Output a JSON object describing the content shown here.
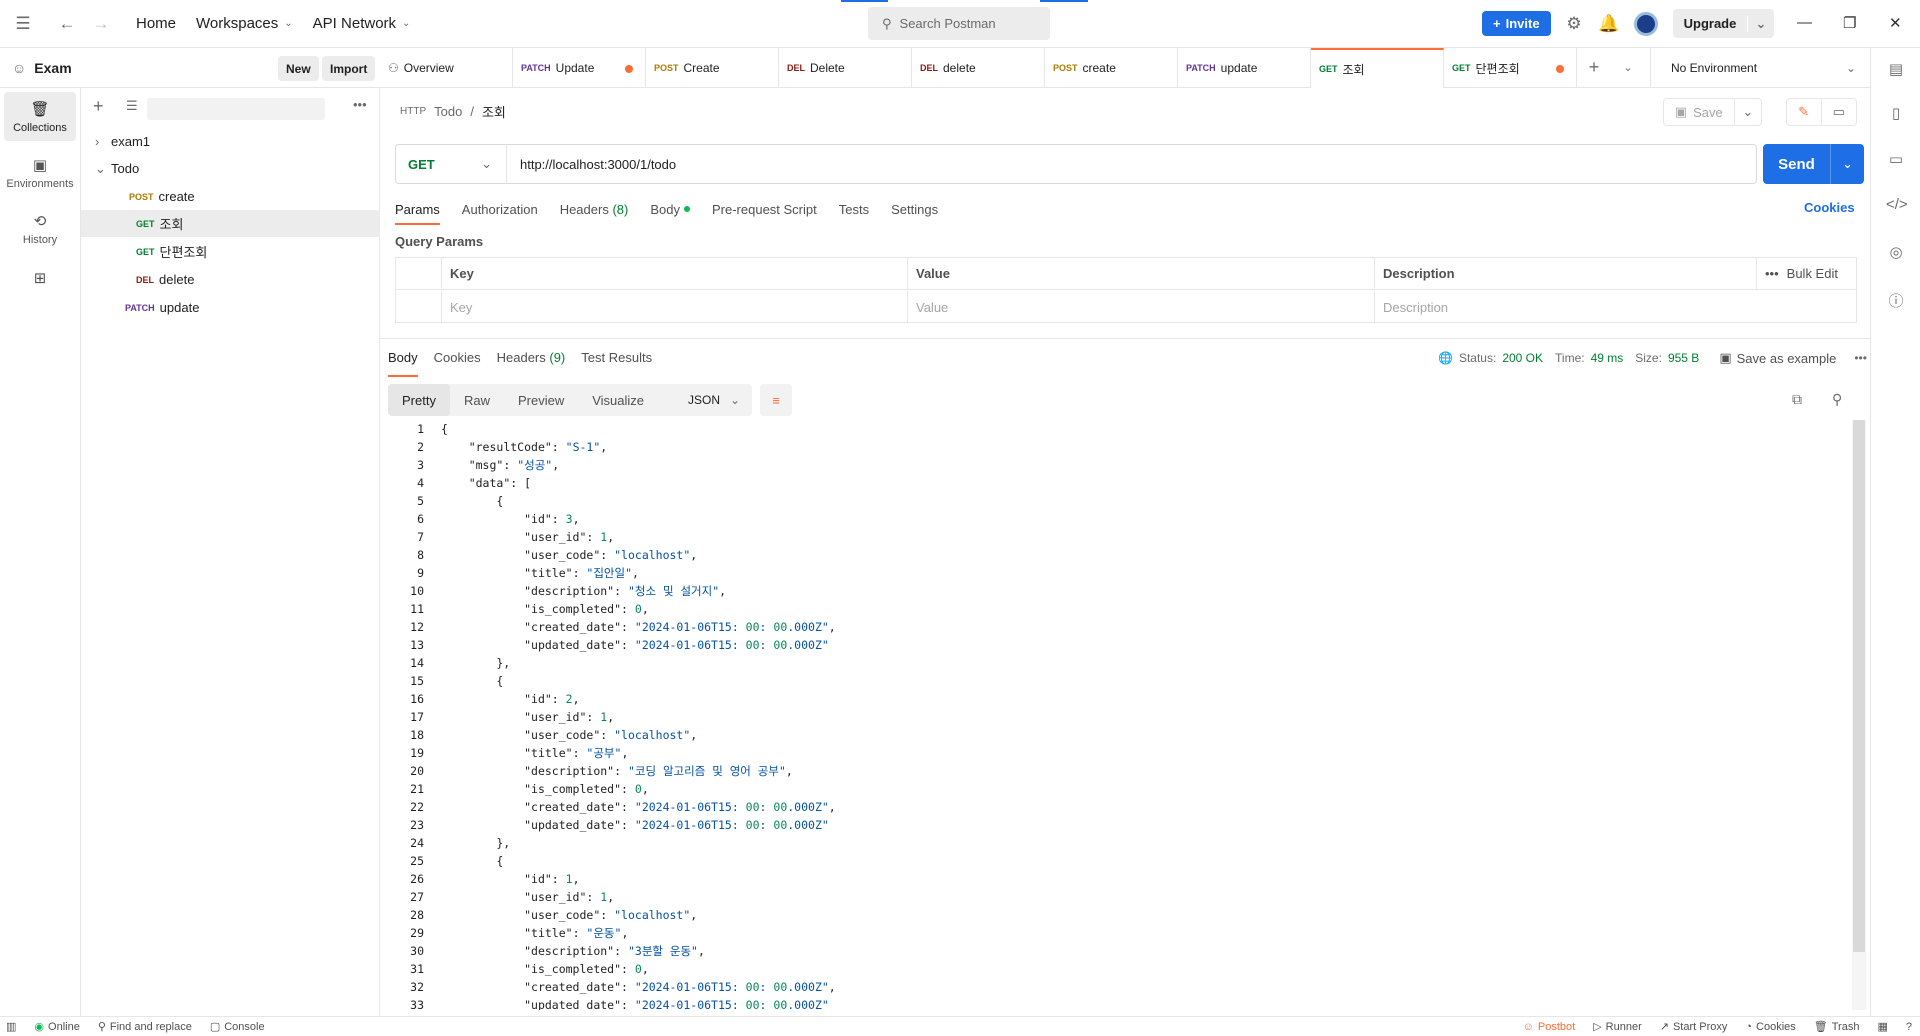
{
  "topbar": {
    "home": "Home",
    "workspaces": "Workspaces",
    "api_network": "API Network",
    "search_placeholder": "Search Postman",
    "invite": "Invite",
    "upgrade": "Upgrade"
  },
  "workspace": {
    "name": "Exam",
    "new_btn": "New",
    "import_btn": "Import"
  },
  "rail": [
    {
      "label": "Collections",
      "icon": "collections-icon"
    },
    {
      "label": "Environments",
      "icon": "environments-icon"
    },
    {
      "label": "History",
      "icon": "history-icon"
    },
    {
      "label": "",
      "icon": "apps-icon"
    }
  ],
  "tree": [
    {
      "method": "",
      "label": "exam1",
      "type": "folder"
    },
    {
      "method": "",
      "label": "Todo",
      "type": "folder-open"
    },
    {
      "method": "POST",
      "label": "create"
    },
    {
      "method": "GET",
      "label": "조회"
    },
    {
      "method": "GET",
      "label": "단편조회"
    },
    {
      "method": "DEL",
      "label": "delete"
    },
    {
      "method": "PATCH",
      "label": "update"
    }
  ],
  "tabs": [
    {
      "method": "",
      "label": "Overview"
    },
    {
      "method": "PATCH",
      "label": "Update",
      "dirty": true
    },
    {
      "method": "POST",
      "label": "Create"
    },
    {
      "method": "DEL",
      "label": "Delete"
    },
    {
      "method": "DEL",
      "label": "delete"
    },
    {
      "method": "POST",
      "label": "create"
    },
    {
      "method": "PATCH",
      "label": "update"
    },
    {
      "method": "GET",
      "label": "조회",
      "active": true
    },
    {
      "method": "GET",
      "label": "단편조회",
      "dirty": true
    }
  ],
  "environment": "No Environment",
  "request": {
    "breadcrumb_parent": "Todo",
    "breadcrumb_current": "조회",
    "save": "Save",
    "method": "GET",
    "url": "http://localhost:3000/1/todo",
    "send": "Send",
    "tabs": [
      "Params",
      "Authorization",
      "Headers",
      "Body",
      "Pre-request Script",
      "Tests",
      "Settings"
    ],
    "headers_count": "(8)",
    "cookies": "Cookies",
    "query_params_title": "Query Params",
    "params_headers": {
      "key": "Key",
      "value": "Value",
      "description": "Description",
      "bulk_edit": "Bulk Edit"
    },
    "params_placeholders": {
      "key": "Key",
      "value": "Value",
      "description": "Description"
    }
  },
  "response": {
    "tabs": [
      "Body",
      "Cookies",
      "Headers",
      "Test Results"
    ],
    "headers_count": "(9)",
    "status_label": "Status:",
    "status_value": "200 OK",
    "time_label": "Time:",
    "time_value": "49 ms",
    "size_label": "Size:",
    "size_value": "955 B",
    "save_example": "Save as example",
    "view_modes": [
      "Pretty",
      "Raw",
      "Preview",
      "Visualize"
    ],
    "format": "JSON",
    "lines": [
      "{",
      "    \"resultCode\": \"S-1\",",
      "    \"msg\": \"성공\",",
      "    \"data\": [",
      "        {",
      "            \"id\": 3,",
      "            \"user_id\": 1,",
      "            \"user_code\": \"localhost\",",
      "            \"title\": \"집안일\",",
      "            \"description\": \"청소 및 설거지\",",
      "            \"is_completed\": 0,",
      "            \"created_date\": \"2024-01-06T15:00:00.000Z\",",
      "            \"updated_date\": \"2024-01-06T15:00:00.000Z\"",
      "        },",
      "        {",
      "            \"id\": 2,",
      "            \"user_id\": 1,",
      "            \"user_code\": \"localhost\",",
      "            \"title\": \"공부\",",
      "            \"description\": \"코딩 알고리즘 및 영어 공부\",",
      "            \"is_completed\": 0,",
      "            \"created_date\": \"2024-01-06T15:00:00.000Z\",",
      "            \"updated_date\": \"2024-01-06T15:00:00.000Z\"",
      "        },",
      "        {",
      "            \"id\": 1,",
      "            \"user_id\": 1,",
      "            \"user_code\": \"localhost\",",
      "            \"title\": \"운동\",",
      "            \"description\": \"3분할 운동\",",
      "            \"is_completed\": 0,",
      "            \"created_date\": \"2024-01-06T15:00:00.000Z\",",
      "            \"updated_date\": \"2024-01-06T15:00:00.000Z\""
    ]
  },
  "statusbar": {
    "online": "Online",
    "find_replace": "Find and replace",
    "console": "Console",
    "postbot": "Postbot",
    "runner": "Runner",
    "start_proxy": "Start Proxy",
    "cookies": "Cookies",
    "trash": "Trash"
  },
  "colors": {
    "accent": "#ff6c37",
    "primary": "#1e6ee6",
    "get": "#007f31",
    "post": "#ad7a03",
    "delete": "#8e1a10",
    "patch": "#623497"
  }
}
